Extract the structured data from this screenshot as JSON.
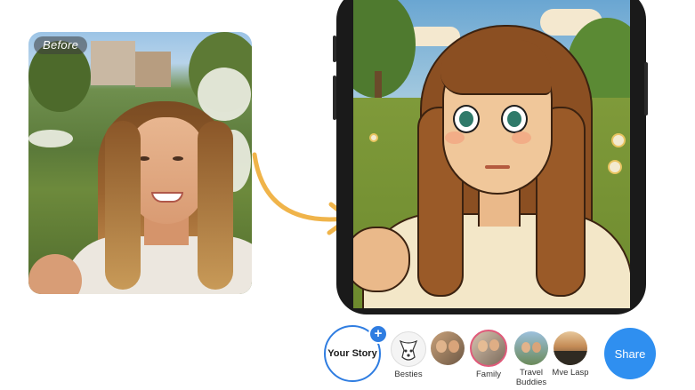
{
  "before_photo": {
    "badge_label": "Before"
  },
  "stories": {
    "your_story_label": "Your Story",
    "add_symbol": "+",
    "items": [
      {
        "label": "Besties",
        "icon": "dog-icon"
      },
      {
        "label": "",
        "icon": "group-photo"
      },
      {
        "label": "Family",
        "icon": "family-photo"
      },
      {
        "label": "Travel\nBuddies",
        "icon": "travel-photo"
      },
      {
        "label": "Mve Lasp",
        "icon": "landscape-photo"
      }
    ],
    "share_label": "Share"
  },
  "colors": {
    "accent": "#2f7de1",
    "share": "#2f8ff0",
    "arrow": "#f0b44a"
  }
}
